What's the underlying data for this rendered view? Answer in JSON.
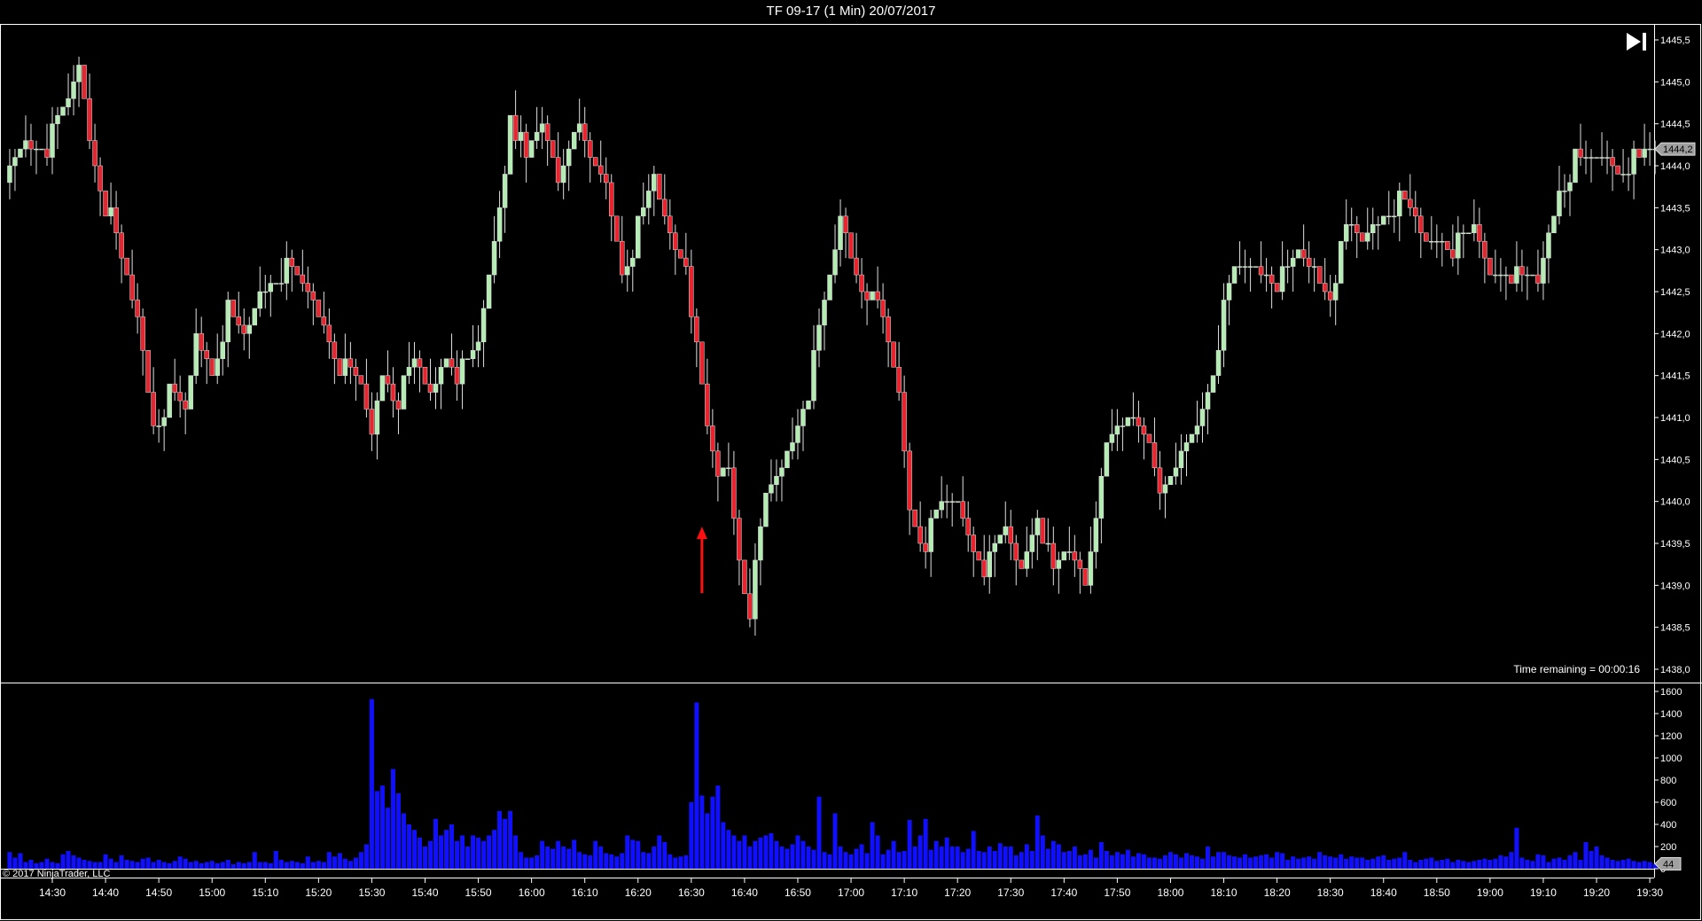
{
  "window": {
    "title": "TF 09-17 (1 Min)  20/07/2017"
  },
  "status": {
    "time_remaining": "Time remaining = 00:00:16",
    "copyright": "© 2017 NinjaTrader, LLC"
  },
  "icons": {
    "scroll_end": "skip-to-end-icon"
  },
  "colors": {
    "background": "#000000",
    "up_candle": "#b4ecb4",
    "down_candle": "#e8252f",
    "wick": "#e0e0e0",
    "volume": "#1010ff",
    "annotation_arrow": "#ff1010",
    "axis": "#ffffff",
    "last_price_marker": "#a0a0a0"
  },
  "chart_data": [
    {
      "type": "candlestick",
      "instrument": "TF 09-17",
      "interval": "1 Min",
      "date": "20/07/2017",
      "first_bar": "14:22",
      "last_bar": "19:31",
      "ylim": [
        1438.0,
        1445.5
      ],
      "yticks": [
        "1445,5",
        "1445,0",
        "1444,5",
        "1444,0",
        "1443,5",
        "1443,0",
        "1442,5",
        "1442,0",
        "1441,5",
        "1441,0",
        "1440,5",
        "1440,0",
        "1439,5",
        "1439,0",
        "1438,5",
        "1438,0"
      ],
      "last_price": "1444,2",
      "close_samples": [
        [
          "14:22",
          1443.9
        ],
        [
          "14:25",
          1444.3
        ],
        [
          "14:30",
          1444.3
        ],
        [
          "14:33",
          1444.7
        ],
        [
          "14:35",
          1445.2
        ],
        [
          "14:37",
          1444.4
        ],
        [
          "14:40",
          1443.6
        ],
        [
          "14:43",
          1442.8
        ],
        [
          "14:46",
          1442.2
        ],
        [
          "14:49",
          1441.0
        ],
        [
          "14:52",
          1441.2
        ],
        [
          "14:55",
          1441.0
        ],
        [
          "14:57",
          1442.0
        ],
        [
          "15:00",
          1441.6
        ],
        [
          "15:03",
          1442.2
        ],
        [
          "15:06",
          1441.9
        ],
        [
          "15:09",
          1442.5
        ],
        [
          "15:13",
          1442.8
        ],
        [
          "15:17",
          1442.5
        ],
        [
          "15:21",
          1442.2
        ],
        [
          "15:25",
          1441.5
        ],
        [
          "15:28",
          1441.3
        ],
        [
          "15:30",
          1440.8
        ],
        [
          "15:32",
          1441.6
        ],
        [
          "15:35",
          1441.2
        ],
        [
          "15:38",
          1441.6
        ],
        [
          "15:41",
          1441.3
        ],
        [
          "15:44",
          1441.8
        ],
        [
          "15:47",
          1441.5
        ],
        [
          "15:50",
          1441.8
        ],
        [
          "15:52",
          1442.7
        ],
        [
          "15:55",
          1444.0
        ],
        [
          "15:56",
          1444.7
        ],
        [
          "15:59",
          1444.0
        ],
        [
          "16:02",
          1444.5
        ],
        [
          "16:05",
          1443.9
        ],
        [
          "16:08",
          1444.5
        ],
        [
          "16:11",
          1444.0
        ],
        [
          "16:14",
          1443.8
        ],
        [
          "16:17",
          1442.8
        ],
        [
          "16:20",
          1443.2
        ],
        [
          "16:23",
          1443.8
        ],
        [
          "16:26",
          1443.2
        ],
        [
          "16:29",
          1442.9
        ],
        [
          "16:31",
          1441.7
        ],
        [
          "16:33",
          1440.8
        ],
        [
          "16:35",
          1440.3
        ],
        [
          "16:37",
          1440.4
        ],
        [
          "16:39",
          1439.4
        ],
        [
          "16:41",
          1438.7
        ],
        [
          "16:44",
          1440.0
        ],
        [
          "16:47",
          1440.4
        ],
        [
          "16:50",
          1441.0
        ],
        [
          "16:53",
          1441.6
        ],
        [
          "16:56",
          1442.6
        ],
        [
          "16:58",
          1443.4
        ],
        [
          "17:00",
          1443.0
        ],
        [
          "17:03",
          1442.5
        ],
        [
          "17:06",
          1442.1
        ],
        [
          "17:09",
          1441.3
        ],
        [
          "17:11",
          1440.0
        ],
        [
          "17:14",
          1439.5
        ],
        [
          "17:17",
          1439.9
        ],
        [
          "17:20",
          1440.0
        ],
        [
          "17:23",
          1439.5
        ],
        [
          "17:26",
          1439.2
        ],
        [
          "17:29",
          1439.6
        ],
        [
          "17:32",
          1439.2
        ],
        [
          "17:35",
          1439.9
        ],
        [
          "17:38",
          1439.1
        ],
        [
          "17:41",
          1439.4
        ],
        [
          "17:44",
          1439.1
        ],
        [
          "17:47",
          1440.4
        ],
        [
          "17:50",
          1440.8
        ],
        [
          "17:53",
          1441.0
        ],
        [
          "17:56",
          1440.8
        ],
        [
          "17:59",
          1440.0
        ],
        [
          "18:02",
          1440.5
        ],
        [
          "18:05",
          1440.9
        ],
        [
          "18:08",
          1441.6
        ],
        [
          "18:10",
          1442.2
        ],
        [
          "18:12",
          1442.7
        ],
        [
          "18:15",
          1442.8
        ],
        [
          "18:18",
          1442.8
        ],
        [
          "18:21",
          1442.6
        ],
        [
          "18:24",
          1442.9
        ],
        [
          "18:27",
          1442.8
        ],
        [
          "18:30",
          1442.5
        ],
        [
          "18:33",
          1443.2
        ],
        [
          "18:36",
          1443.1
        ],
        [
          "18:39",
          1443.4
        ],
        [
          "18:42",
          1443.6
        ],
        [
          "18:45",
          1443.4
        ],
        [
          "18:48",
          1443.1
        ],
        [
          "18:51",
          1443.2
        ],
        [
          "18:54",
          1443.0
        ],
        [
          "18:57",
          1443.2
        ],
        [
          "19:00",
          1442.7
        ],
        [
          "19:03",
          1442.8
        ],
        [
          "19:06",
          1442.6
        ],
        [
          "19:09",
          1442.6
        ],
        [
          "19:11",
          1443.2
        ],
        [
          "19:13",
          1443.8
        ],
        [
          "19:16",
          1444.0
        ],
        [
          "19:19",
          1444.0
        ],
        [
          "19:22",
          1444.1
        ],
        [
          "19:25",
          1444.0
        ],
        [
          "19:28",
          1444.0
        ],
        [
          "19:31",
          1444.2
        ]
      ],
      "annotation": {
        "type": "arrow-up",
        "time": "16:32",
        "price": 1439.7
      }
    },
    {
      "type": "bar",
      "series_name": "Volume",
      "ylim": [
        0,
        1600
      ],
      "yticks": [
        "1600",
        "1400",
        "1200",
        "1000",
        "800",
        "600",
        "400",
        "200",
        "0"
      ],
      "last_value": "44",
      "first_bar": "14:22",
      "values": [
        150,
        100,
        140,
        60,
        80,
        50,
        60,
        90,
        60,
        50,
        130,
        160,
        120,
        100,
        80,
        70,
        60,
        60,
        130,
        90,
        60,
        120,
        80,
        70,
        60,
        90,
        100,
        60,
        80,
        60,
        50,
        70,
        110,
        90,
        60,
        70,
        50,
        60,
        70,
        50,
        60,
        80,
        40,
        60,
        50,
        60,
        150,
        60,
        60,
        50,
        160,
        80,
        60,
        70,
        60,
        50,
        110,
        60,
        70,
        60,
        150,
        110,
        140,
        90,
        70,
        100,
        150,
        220,
        1530,
        700,
        750,
        550,
        900,
        680,
        500,
        400,
        350,
        280,
        200,
        250,
        450,
        300,
        350,
        400,
        250,
        300,
        200,
        300,
        280,
        250,
        300,
        350,
        520,
        450,
        520,
        300,
        150,
        100,
        100,
        120,
        250,
        200,
        180,
        250,
        200,
        180,
        260,
        150,
        130,
        120,
        250,
        200,
        140,
        130,
        110,
        140,
        300,
        260,
        250,
        150,
        140,
        200,
        300,
        240,
        130,
        100,
        110,
        120,
        600,
        1500,
        660,
        500,
        650,
        750,
        420,
        350,
        300,
        250,
        300,
        200,
        250,
        280,
        300,
        320,
        250,
        200,
        180,
        220,
        300,
        250,
        200,
        170,
        650,
        150,
        130,
        500,
        200,
        150,
        130,
        180,
        220,
        140,
        420,
        300,
        130,
        170,
        250,
        150,
        160,
        440,
        200,
        300,
        450,
        170,
        250,
        200,
        280,
        200,
        200,
        150,
        180,
        340,
        160,
        150,
        200,
        160,
        230,
        200,
        200,
        120,
        150,
        220,
        160,
        480,
        300,
        180,
        250,
        220,
        150,
        160,
        200,
        120,
        130,
        170,
        100,
        240,
        160,
        120,
        150,
        130,
        170,
        110,
        140,
        130,
        100,
        100,
        90,
        120,
        150,
        130,
        100,
        140,
        120,
        110,
        90,
        200,
        110,
        150,
        150,
        120,
        110,
        100,
        130,
        100,
        110,
        120,
        130,
        100,
        150,
        140,
        80,
        110,
        90,
        100,
        110,
        90,
        150,
        120,
        110,
        100,
        130,
        90,
        110,
        100,
        100,
        80,
        90,
        110,
        120,
        80,
        90,
        100,
        150,
        80,
        60,
        80,
        90,
        100,
        70,
        80,
        90,
        60,
        80,
        70,
        60,
        70,
        80,
        90,
        80,
        90,
        120,
        110,
        150,
        370,
        100,
        80,
        70,
        130,
        120,
        60,
        90,
        100,
        80,
        120,
        150,
        80,
        240,
        160,
        200,
        120,
        100,
        80,
        70,
        80,
        90,
        70,
        60,
        70,
        60,
        44
      ]
    }
  ],
  "time_axis": {
    "ticks": [
      "14:30",
      "14:40",
      "14:50",
      "15:00",
      "15:10",
      "15:20",
      "15:30",
      "15:40",
      "15:50",
      "16:00",
      "16:10",
      "16:20",
      "16:30",
      "16:40",
      "16:50",
      "17:00",
      "17:10",
      "17:20",
      "17:30",
      "17:40",
      "17:50",
      "18:00",
      "18:10",
      "18:20",
      "18:30",
      "18:40",
      "18:50",
      "19:00",
      "19:10",
      "19:20",
      "19:30"
    ]
  }
}
